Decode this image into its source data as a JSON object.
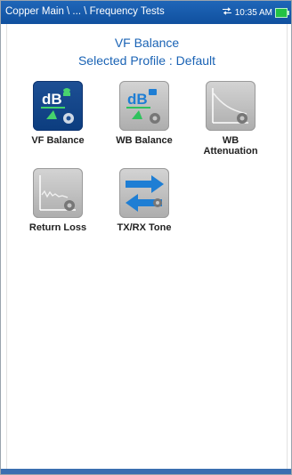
{
  "header": {
    "breadcrumb": "Copper Main \\ ... \\ Frequency Tests",
    "time": "10:35 AM"
  },
  "main": {
    "title": "VF Balance",
    "subtitle": "Selected Profile : Default",
    "tiles": [
      {
        "label": "VF Balance",
        "icon": "vf-balance-icon",
        "selected": true
      },
      {
        "label": "WB Balance",
        "icon": "wb-balance-icon",
        "selected": false
      },
      {
        "label": "WB Attenuation",
        "icon": "wb-attenuation-icon",
        "selected": false
      },
      {
        "label": "Return Loss",
        "icon": "return-loss-icon",
        "selected": false
      },
      {
        "label": "TX/RX Tone",
        "icon": "tx-rx-tone-icon",
        "selected": false
      }
    ]
  },
  "colors": {
    "accent": "#1a63b5",
    "titlebar": "#1458a8",
    "battery": "#22c244"
  }
}
